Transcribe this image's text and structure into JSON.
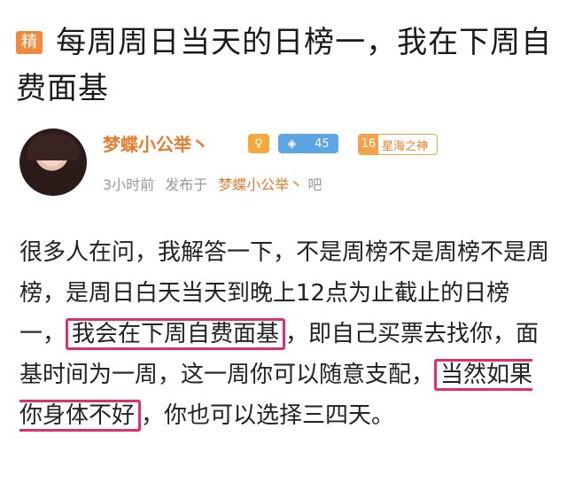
{
  "post": {
    "badge": "精",
    "title": "每周周日当天的日榜一，我在下周自费面基"
  },
  "author": {
    "name": "梦蝶小公举丶",
    "gender_icon": "female-symbol-icon",
    "vip_level": "45",
    "level_number": "16",
    "level_title": "星海之神"
  },
  "meta": {
    "time": "3小时前",
    "posted_in_label": "发布于",
    "forum_name": "梦蝶小公举丶",
    "forum_suffix": "吧"
  },
  "body": {
    "part1": "很多人在问，我解答一下，不是周榜不是周榜不是周榜，是周日白天当天到晚上12点为止截止的日榜一，",
    "highlight1": "我会在下周自费面基",
    "part2": "，即自己买票去找你，面基时间为一周，这一周你可以随意支配，",
    "highlight2": "当然如果你身体不好",
    "part3": "，你也可以选择三四天。"
  },
  "colors": {
    "accent": "#e67a2e",
    "badge": "#f08a3c",
    "highlight_border": "#e0306a",
    "vip": "#5ba5e6"
  }
}
